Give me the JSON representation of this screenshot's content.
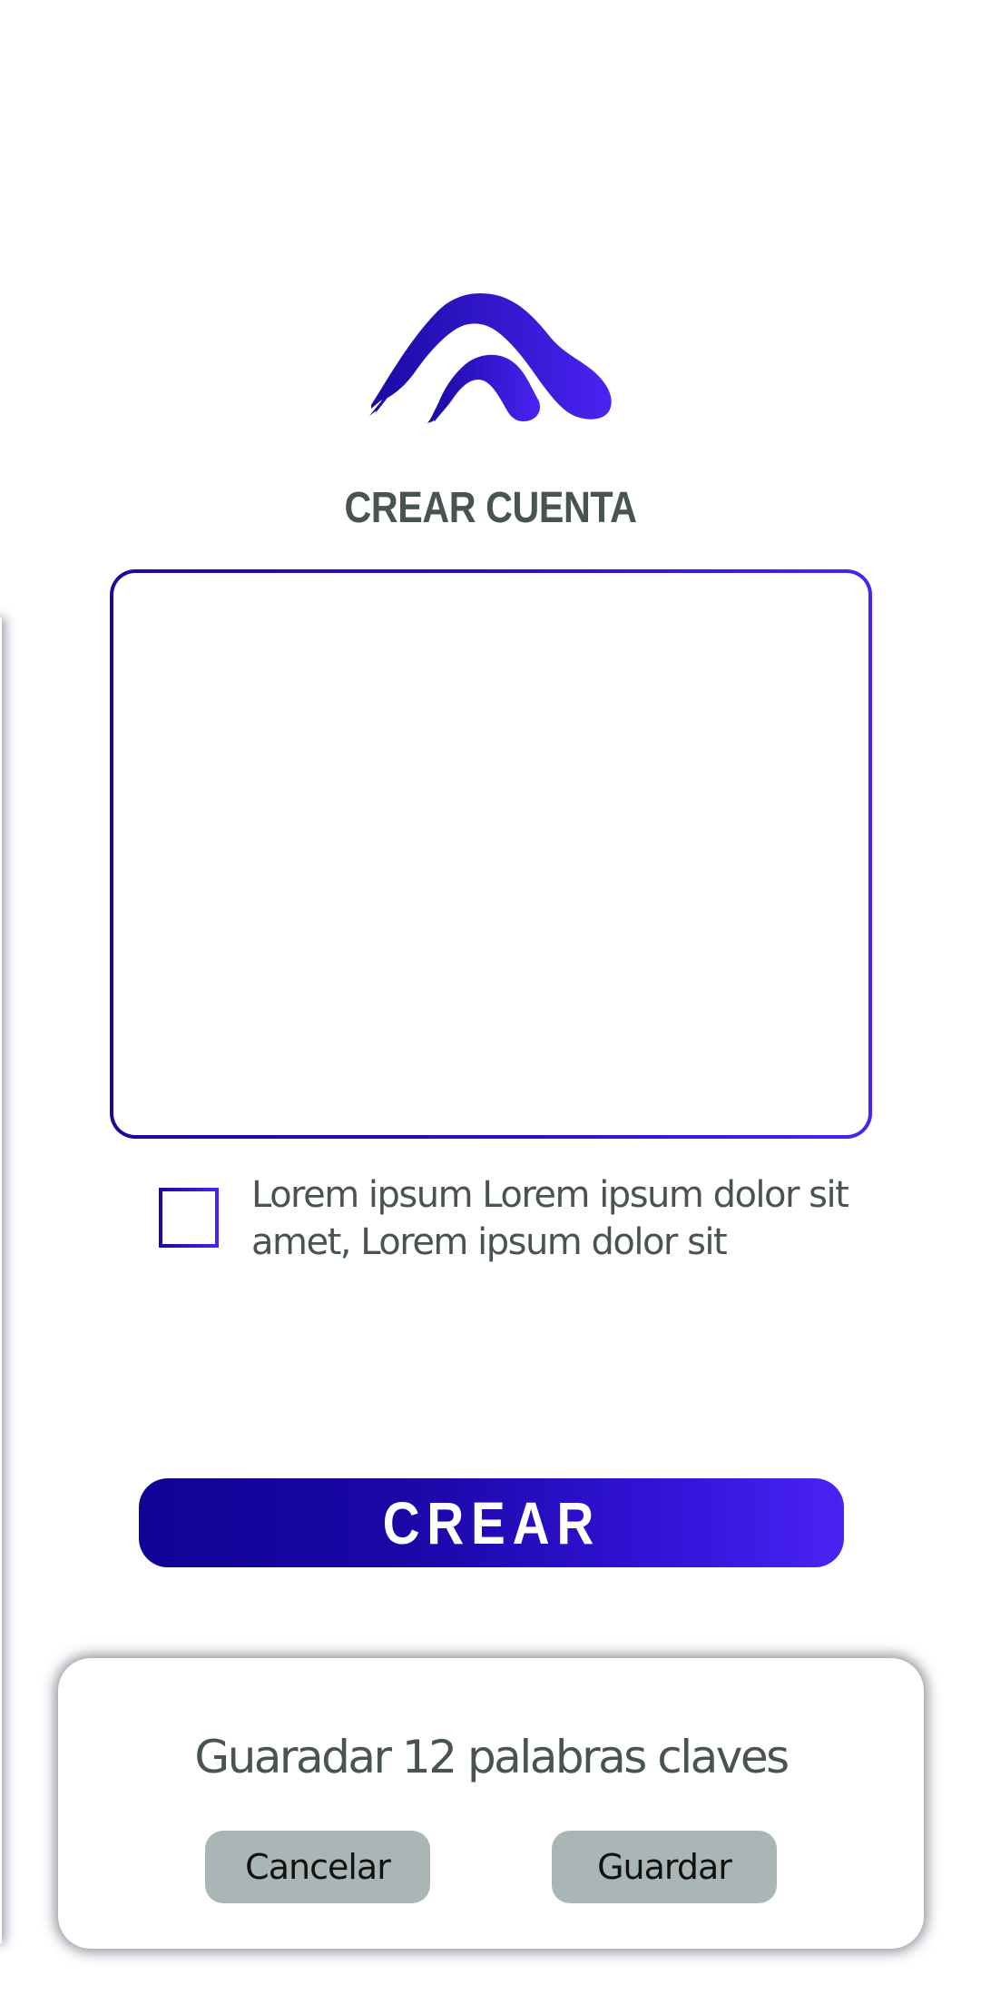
{
  "screen": {
    "title": "CREAR CUENTA"
  },
  "words_box": {
    "value": ""
  },
  "terms": {
    "text": "Lorem ipsum Lorem ipsum dolor sit amet, Lorem ipsum dolor sit",
    "checked": false
  },
  "actions": {
    "create_label": "CREAR"
  },
  "dialog": {
    "message": "Guaradar 12 palabras claves",
    "cancel_label": "Cancelar",
    "save_label": "Guardar"
  },
  "colors": {
    "accent_start": "#0f0394",
    "accent_end": "#4a23f4",
    "text": "#4a5353",
    "dialog_button": "#aab6b6"
  },
  "icons": {
    "logo": "brush-mountain-logo"
  }
}
